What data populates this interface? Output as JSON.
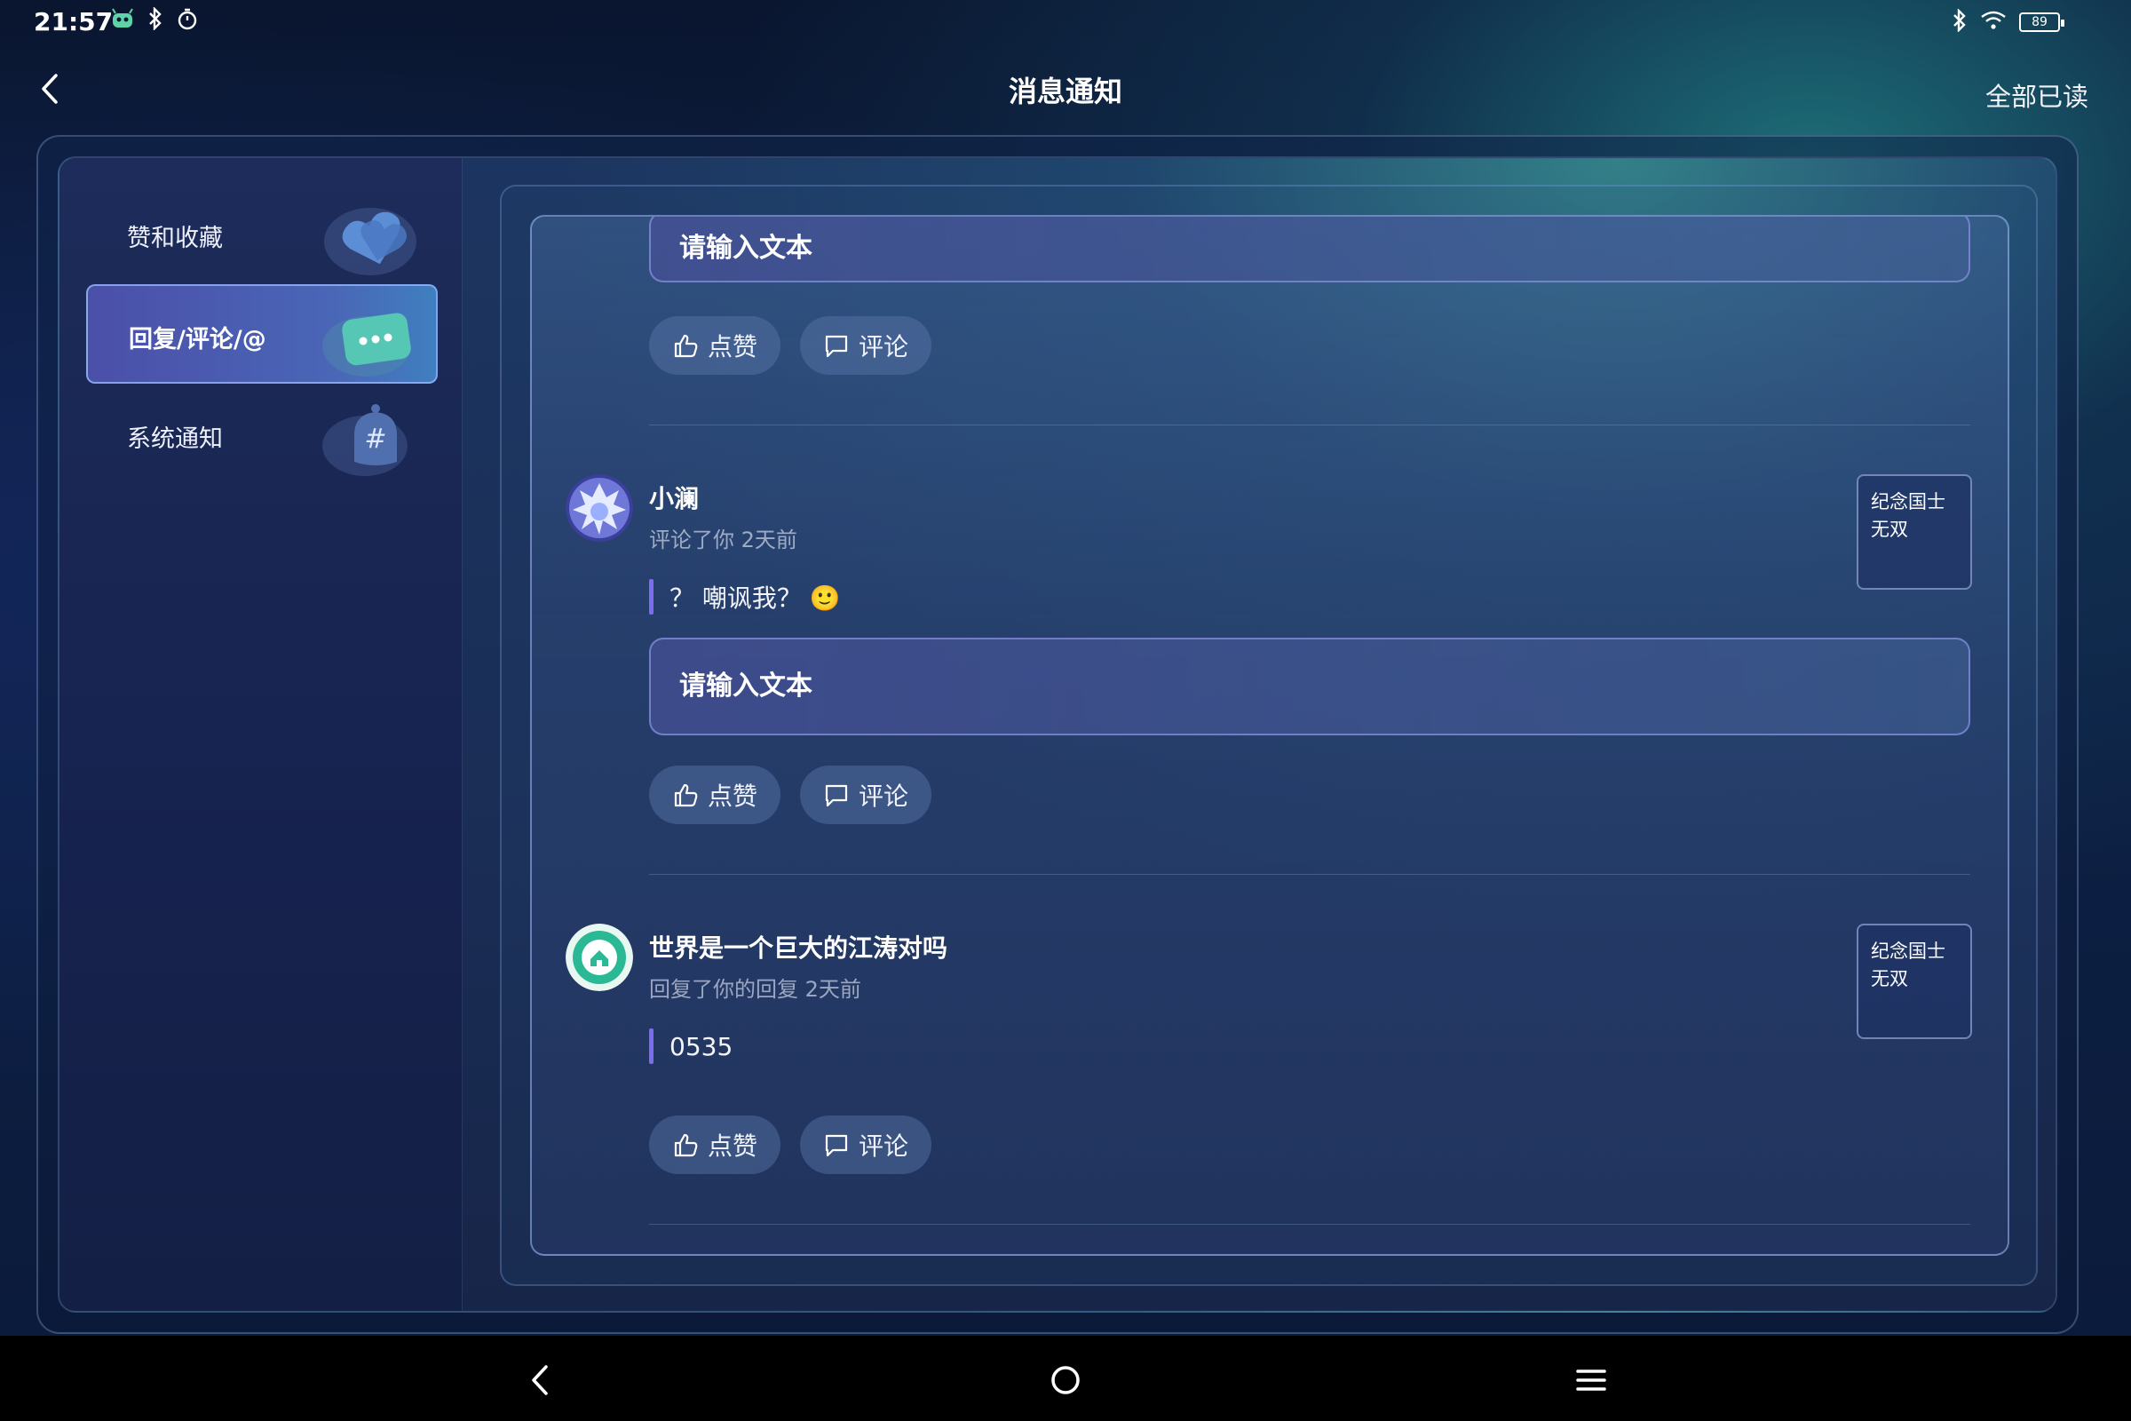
{
  "status_bar": {
    "time": "21:57",
    "battery": "89"
  },
  "header": {
    "title": "消息通知",
    "mark_all_read": "全部已读"
  },
  "sidebar": {
    "items": [
      {
        "label": "赞和收藏",
        "active": false
      },
      {
        "label": "回复/评论/@",
        "active": true
      },
      {
        "label": "系统通知",
        "active": false
      }
    ]
  },
  "messages": {
    "top_input_placeholder": "请输入文本",
    "like_label": "点赞",
    "comment_label": "评论",
    "items": [
      {
        "user": "小澜",
        "meta": "评论了你 2天前",
        "text": "？ 嘲讽我？ 🙂",
        "input_placeholder": "请输入文本",
        "tag": "纪念国士无双"
      },
      {
        "user": "世界是一个巨大的江涛对吗",
        "meta": "回复了你的回复 2天前",
        "text": "0535",
        "tag": "纪念国士无双"
      }
    ]
  },
  "colors": {
    "accent": "#7c6cf0",
    "active_tab": "#4b4fa8",
    "background": "#0d2145"
  }
}
